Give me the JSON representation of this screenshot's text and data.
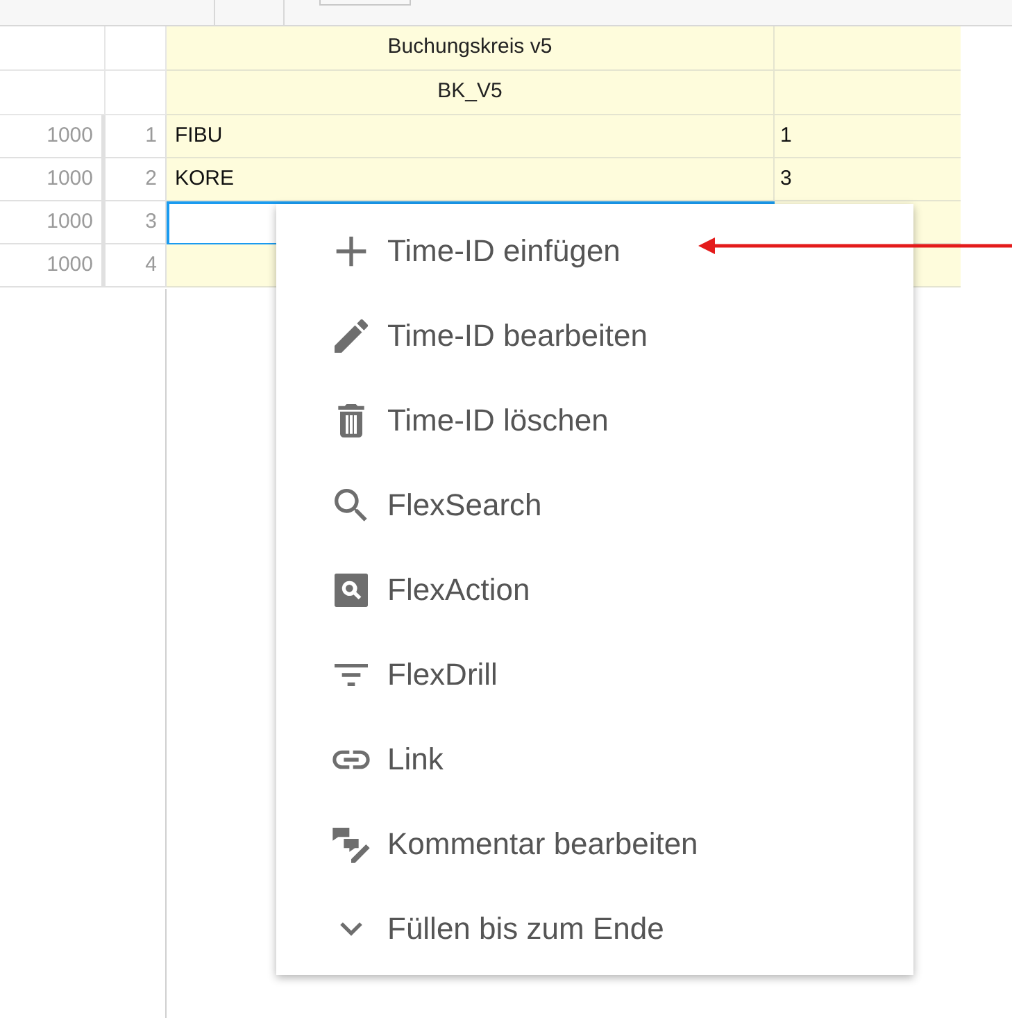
{
  "grid": {
    "header_rows": [
      "Buchungskreis v5",
      "BK_V5"
    ],
    "rows": [
      {
        "column_1": "1000",
        "row_number": "1",
        "column_3": "FIBU",
        "column_4": "1",
        "selected": false
      },
      {
        "column_1": "1000",
        "row_number": "2",
        "column_3": "KORE",
        "column_4": "3",
        "selected": false
      },
      {
        "column_1": "1000",
        "row_number": "3",
        "selected": true
      },
      {
        "column_1": "1000",
        "row_number": "4",
        "selected": false
      }
    ]
  },
  "context_menu": {
    "items": [
      {
        "label": "Time-ID einfügen",
        "kind": "plus"
      },
      {
        "label": "Time-ID bearbeiten",
        "kind": "pencil"
      },
      {
        "label": "Time-ID löschen",
        "kind": "trash"
      },
      {
        "label": "FlexSearch",
        "kind": "search"
      },
      {
        "label": "FlexAction",
        "kind": "search-box"
      },
      {
        "label": "FlexDrill",
        "kind": "filter"
      },
      {
        "label": "Link",
        "kind": "link"
      },
      {
        "label": "Kommentar bearbeiten",
        "kind": "comment-edit"
      },
      {
        "label": "Füllen bis zum Ende",
        "kind": "chevron"
      }
    ]
  }
}
